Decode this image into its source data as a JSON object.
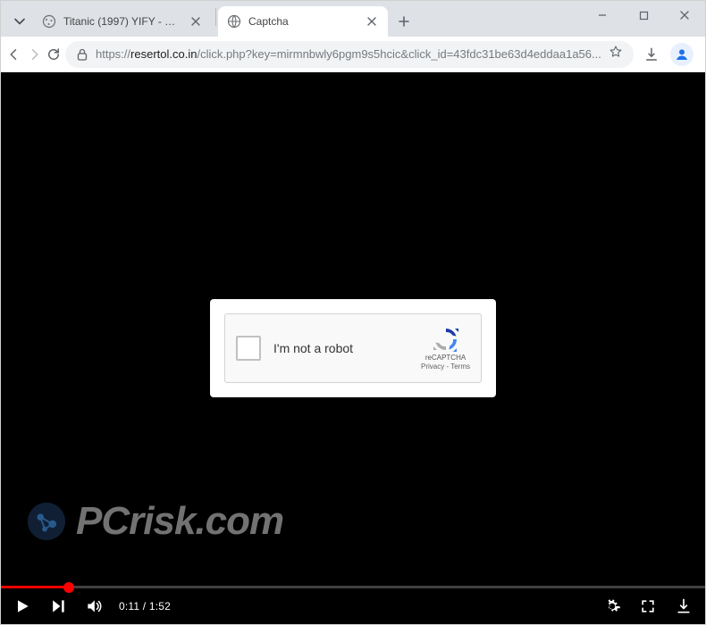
{
  "tabs": [
    {
      "title": "Titanic (1997) YIFY - Download",
      "favicon": "globe-dots"
    },
    {
      "title": "Captcha",
      "favicon": "globe"
    }
  ],
  "active_tab_index": 1,
  "address": {
    "scheme": "https://",
    "host": "resertol.co.in",
    "path": "/click.php?key=mirmnbwly6pgm9s5hcic&click_id=43fdc31be63d4eddaa1a56..."
  },
  "captcha": {
    "label": "I'm not a robot",
    "brand": "reCAPTCHA",
    "privacy_terms": "Privacy - Terms"
  },
  "watermark": {
    "text": "PCrisk.com"
  },
  "player": {
    "current": "0:11",
    "duration": "1:52",
    "progress_percent": 9.6
  },
  "colors": {
    "accent_red": "#ff0000",
    "chrome_tabstrip": "#dee1e6",
    "omnibox_bg": "#f1f3f4",
    "avatar_blue": "#1a73e8"
  }
}
